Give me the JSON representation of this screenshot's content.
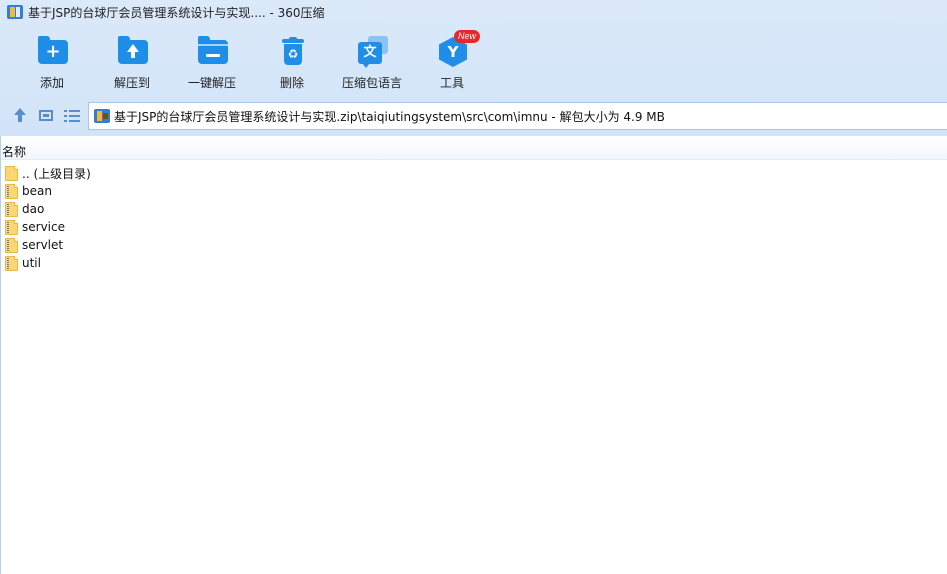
{
  "window": {
    "title": "基于JSP的台球厅会员管理系统设计与实现.... - 360压缩"
  },
  "toolbar": {
    "add_label": "添加",
    "extract_to_label": "解压到",
    "one_click_extract_label": "一键解压",
    "delete_label": "删除",
    "archive_language_label": "压缩包语言",
    "tools_label": "工具",
    "tools_badge": "New",
    "language_glyph": "文"
  },
  "navigation": {
    "path": "基于JSP的台球厅会员管理系统设计与实现.zip\\taiqiutingsystem\\src\\com\\imnu - 解包大小为 4.9 MB"
  },
  "file_list": {
    "column_name": "名称",
    "items": [
      {
        "name": ".. (上级目录)",
        "type": "parent"
      },
      {
        "name": "bean",
        "type": "folder"
      },
      {
        "name": "dao",
        "type": "folder"
      },
      {
        "name": "service",
        "type": "folder"
      },
      {
        "name": "servlet",
        "type": "folder"
      },
      {
        "name": "util",
        "type": "folder"
      }
    ]
  },
  "colors": {
    "accent": "#1e8ee8",
    "toolbar_background": "#d5e6f9",
    "badge": "#e8262d",
    "folder": "#fbd774"
  }
}
